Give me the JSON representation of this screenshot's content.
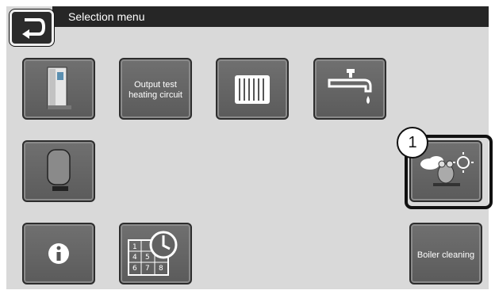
{
  "header": {
    "title": "Selection menu"
  },
  "tiles": {
    "boiler": {
      "icon": "boiler-unit-icon"
    },
    "output_test": {
      "label_line1": "Output test",
      "label_line2": "heating circuit"
    },
    "radiator": {
      "icon": "radiator-icon"
    },
    "hot_water": {
      "icon": "faucet-water-icon"
    },
    "buffer": {
      "icon": "buffer-tank-icon"
    },
    "frog": {
      "icon": "weather-frog-icon"
    },
    "info": {
      "icon": "info-icon"
    },
    "schedule": {
      "icon": "calendar-clock-icon",
      "days": [
        "1",
        "2",
        "3",
        "4",
        "5",
        "6",
        "7",
        "8"
      ]
    },
    "boiler_cleaning": {
      "label": "Boiler cleaning"
    }
  },
  "annotation": {
    "marker": "1"
  },
  "colors": {
    "tile": "#626262",
    "background": "#d9d9d9",
    "titlebar": "#262626",
    "highlight": "#111111"
  }
}
